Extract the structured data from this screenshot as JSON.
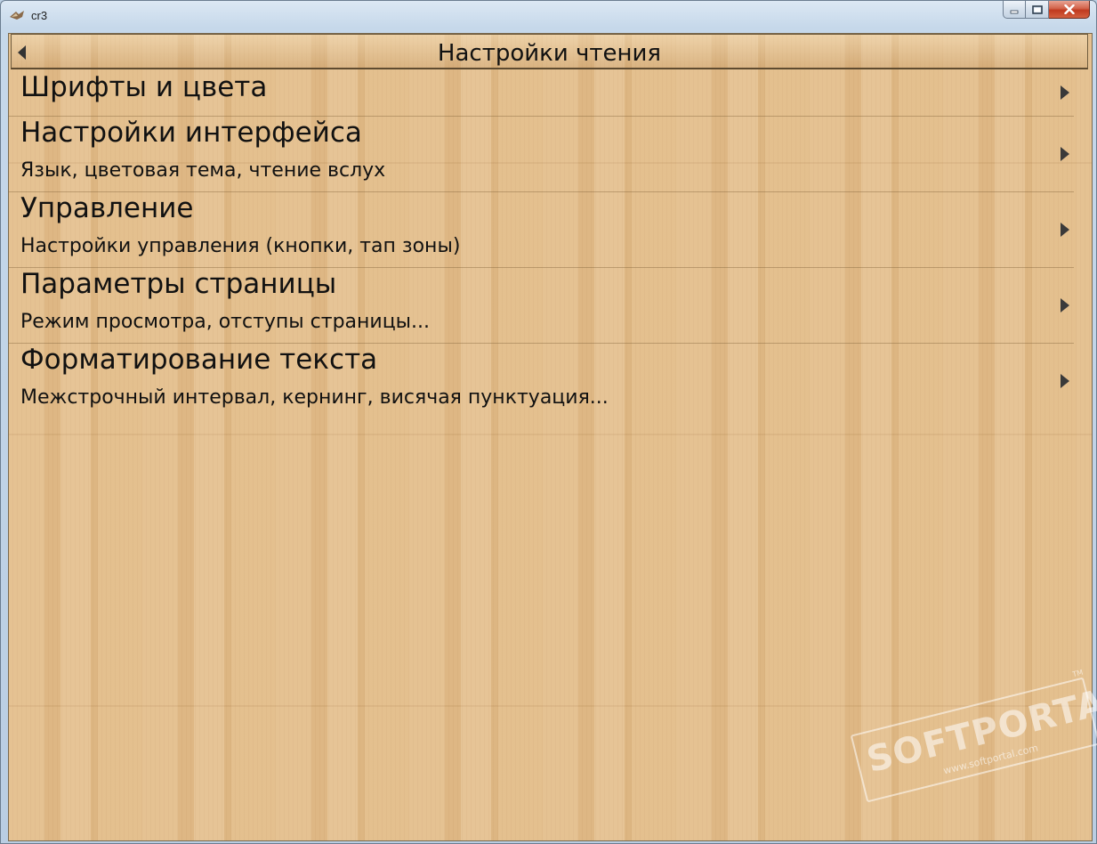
{
  "window": {
    "title": "cr3",
    "controls": {
      "minimize": "minimize",
      "maximize": "maximize",
      "close": "close"
    }
  },
  "header": {
    "title": "Настройки чтения",
    "back_icon": "back-arrow-icon"
  },
  "menu": {
    "items": [
      {
        "title": "Шрифты и цвета",
        "subtitle": ""
      },
      {
        "title": "Настройки интерфейса",
        "subtitle": "Язык, цветовая тема, чтение вслух"
      },
      {
        "title": "Управление",
        "subtitle": "Настройки управления (кнопки, тап зоны)"
      },
      {
        "title": "Параметры страницы",
        "subtitle": "Режим просмотра, отступы страницы..."
      },
      {
        "title": "Форматирование текста",
        "subtitle": "Межстрочный интервал, кернинг, висячая пунктуация..."
      }
    ]
  },
  "watermark": {
    "brand": "SOFTPORTAL",
    "url": "www.softportal.com",
    "tm": "TM"
  },
  "colors": {
    "wood": "#e3bd8a",
    "text": "#111111",
    "chevron": "#3a3a3a"
  }
}
